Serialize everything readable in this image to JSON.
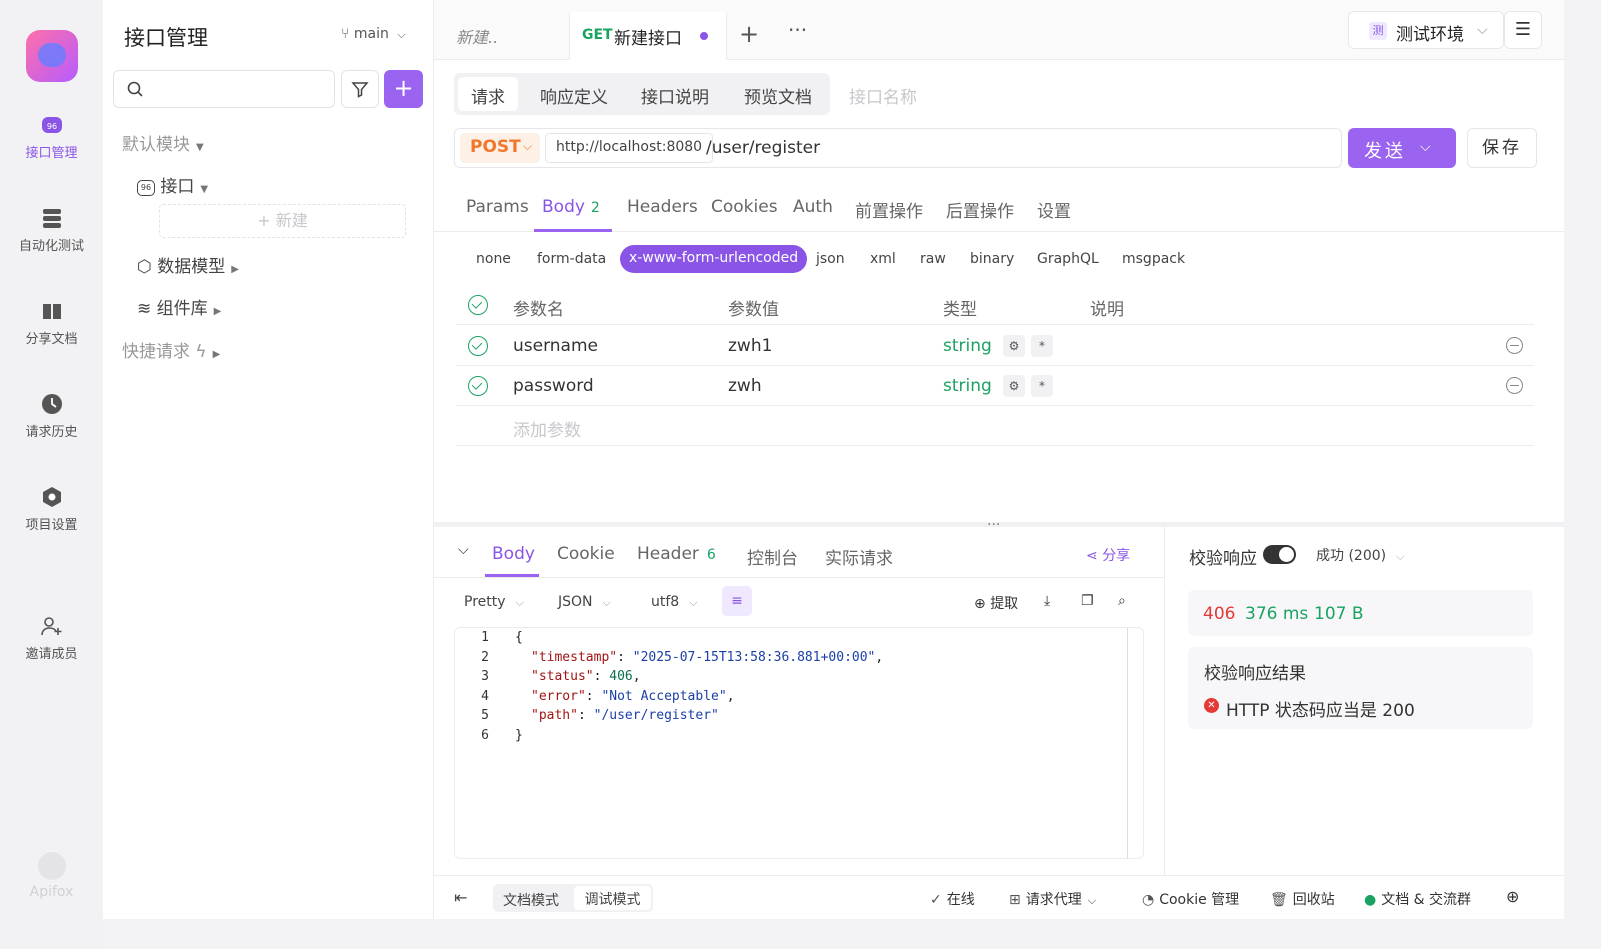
{
  "colors": {
    "accent": "#9a64f0",
    "success": "#1aa360",
    "error": "#e53935",
    "method_post": "#f0772c"
  },
  "rail": {
    "items": [
      {
        "label": "接口管理",
        "icon": "api-icon",
        "active": true
      },
      {
        "label": "自动化测试",
        "icon": "stack-icon",
        "active": false
      },
      {
        "label": "分享文档",
        "icon": "book-icon",
        "active": false
      },
      {
        "label": "请求历史",
        "icon": "clock-icon",
        "active": false
      },
      {
        "label": "项目设置",
        "icon": "settings-hex-icon",
        "active": false
      },
      {
        "label": "邀请成员",
        "icon": "user-add-icon",
        "active": false
      }
    ],
    "brand": "Apifox"
  },
  "tree": {
    "title": "接口管理",
    "branch": "main",
    "nodes": {
      "default_module": "默认模块",
      "api": "接口",
      "new": "+ 新建",
      "data_model": "数据模型",
      "components": "组件库",
      "quick_request": "快捷请求"
    }
  },
  "tabs": {
    "draft": "新建..",
    "active_method": "GET",
    "active_title": "新建接口",
    "plus": "+",
    "more": "···"
  },
  "env": {
    "badge": "测",
    "name": "测试环境"
  },
  "request": {
    "tabs": [
      "请求",
      "响应定义",
      "接口说明",
      "预览文档"
    ],
    "name_placeholder": "接口名称",
    "method": "POST",
    "host": "http://localhost:8080",
    "path": "/user/register",
    "send": "发送",
    "save": "保存"
  },
  "param_tabs": [
    {
      "label": "Params",
      "count": ""
    },
    {
      "label": "Body",
      "count": "2"
    },
    {
      "label": "Headers",
      "count": ""
    },
    {
      "label": "Cookies",
      "count": ""
    },
    {
      "label": "Auth",
      "count": ""
    },
    {
      "label": "前置操作",
      "count": ""
    },
    {
      "label": "后置操作",
      "count": ""
    },
    {
      "label": "设置",
      "count": ""
    }
  ],
  "body_types": [
    "none",
    "form-data",
    "x-www-form-urlencoded",
    "json",
    "xml",
    "raw",
    "binary",
    "GraphQL",
    "msgpack"
  ],
  "params_table": {
    "headers": [
      "参数名",
      "参数值",
      "类型",
      "说明"
    ],
    "rows": [
      {
        "name": "username",
        "value": "zwh1",
        "type": "string"
      },
      {
        "name": "password",
        "value": "zwh",
        "type": "string"
      }
    ],
    "add_placeholder": "添加参数"
  },
  "response": {
    "tabs": [
      {
        "label": "Body",
        "count": ""
      },
      {
        "label": "Cookie",
        "count": ""
      },
      {
        "label": "Header",
        "count": "6"
      },
      {
        "label": "控制台",
        "count": ""
      },
      {
        "label": "实际请求",
        "count": ""
      }
    ],
    "share": "分享",
    "format": [
      "Pretty",
      "JSON",
      "utf8"
    ],
    "actions": {
      "extract": "提取"
    },
    "code_lines": [
      {
        "n": "1",
        "text": "{"
      },
      {
        "n": "2",
        "key": "\"timestamp\"",
        "val": "\"2025-07-15T13:58:36.881+00:00\"",
        "tail": ","
      },
      {
        "n": "3",
        "key": "\"status\"",
        "num": "406",
        "tail": ","
      },
      {
        "n": "4",
        "key": "\"error\"",
        "val": "\"Not Acceptable\"",
        "tail": ","
      },
      {
        "n": "5",
        "key": "\"path\"",
        "val": "\"/user/register\"",
        "tail": ""
      },
      {
        "n": "6",
        "text": "}"
      }
    ]
  },
  "validate": {
    "title": "校验响应",
    "enabled": true,
    "select": "成功 (200)",
    "status": "406",
    "time": "376 ms",
    "size": "107 B",
    "result_title": "校验响应结果",
    "result_msg": "HTTP 状态码应当是 200"
  },
  "footer": {
    "modes": [
      "文档模式",
      "调试模式"
    ],
    "online": "在线",
    "proxy": "请求代理",
    "cookie": "Cookie 管理",
    "trash": "回收站",
    "docs": "文档 & 交流群"
  }
}
